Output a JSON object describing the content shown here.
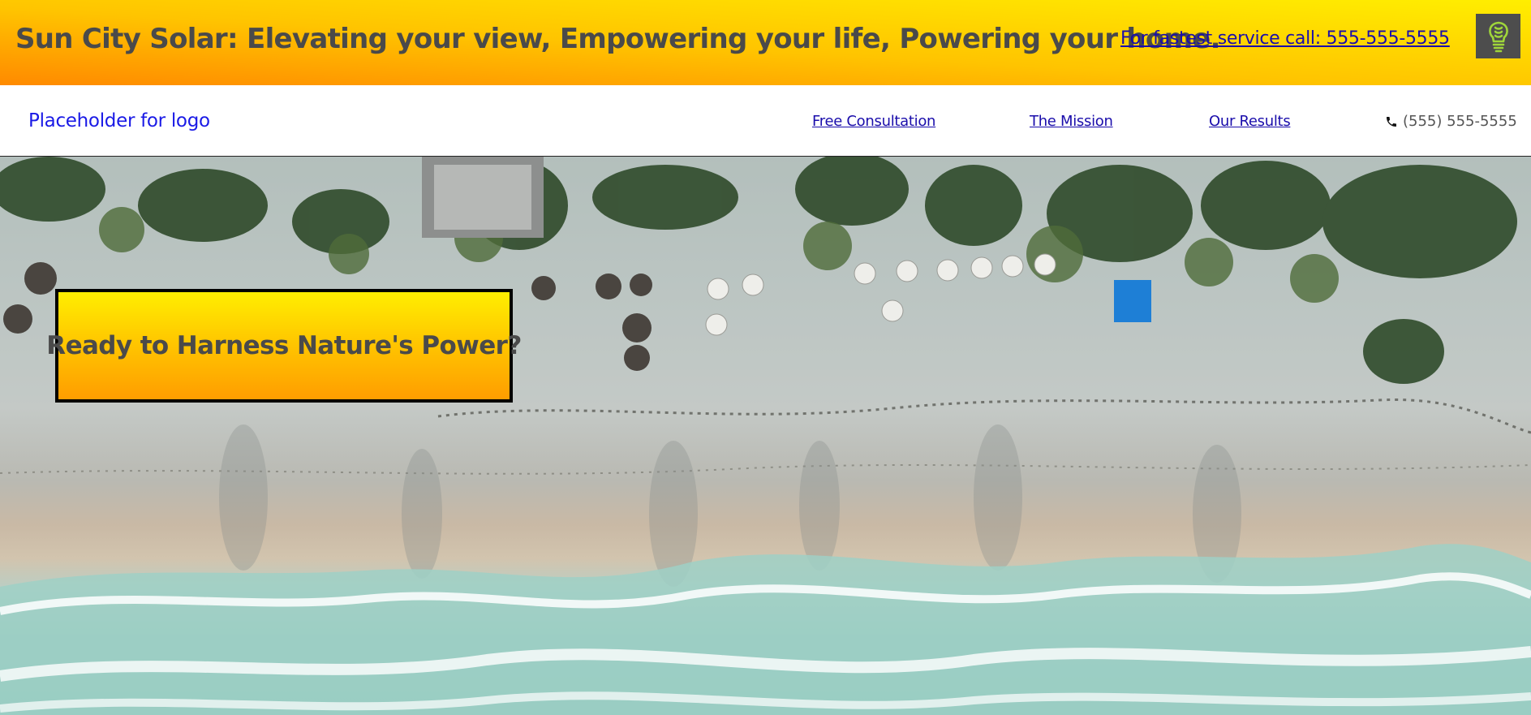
{
  "banner": {
    "title": "Sun City Solar: Elevating your view, Empowering your life, Powering your home.",
    "call_link": "For fastest service call: 555-555-5555",
    "icon": "lightbulb-icon",
    "gradient_colors": [
      "#ff8a00",
      "#ffc400",
      "#ffee00"
    ]
  },
  "nav": {
    "logo": "Placeholder for logo",
    "links": [
      {
        "label": "Free Consultation"
      },
      {
        "label": "The Mission"
      },
      {
        "label": "Our Results"
      }
    ],
    "phone_icon": "phone-icon",
    "phone": "(555) 555-5555"
  },
  "hero": {
    "image": "aerial beach photo",
    "cta": "Ready to Harness Nature's Power?"
  }
}
